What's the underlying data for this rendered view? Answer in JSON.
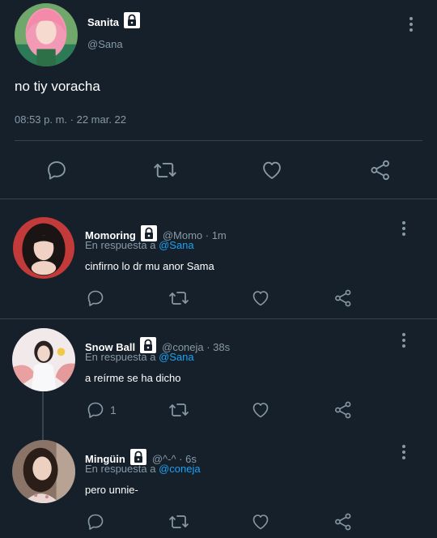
{
  "main_tweet": {
    "name": "Sanita",
    "handle": "@Sana",
    "text": "no tiy voracha",
    "timestamp": "08:53 p. m. · 22 mar. 22"
  },
  "replies": [
    {
      "name": "Momoring",
      "meta": "@Momo · 1m",
      "replying_prefix": "En respuesta a",
      "replying_to": "@Sana",
      "text": "cinfirno lo dr mu anor Sama",
      "reply_count": ""
    },
    {
      "name": "Snow Ball",
      "meta": "@coneja · 38s",
      "replying_prefix": "En respuesta a",
      "replying_to": "@Sana",
      "text": "a reírme se ha dicho",
      "reply_count": "1"
    },
    {
      "name": "Mingüin",
      "meta": "@^-^ · 6s",
      "replying_prefix": "En respuesta a",
      "replying_to": "@coneja",
      "text": "pero unnie-",
      "reply_count": ""
    }
  ],
  "icons": {
    "lock": "lock-icon",
    "reply": "reply-icon",
    "retweet": "retweet-icon",
    "like": "heart-icon",
    "share": "share-icon",
    "more": "more-vertical-icon"
  },
  "colors": {
    "background": "#15202b",
    "divider": "#38444d",
    "muted_text": "#8899a6",
    "link": "#1da1f2"
  }
}
